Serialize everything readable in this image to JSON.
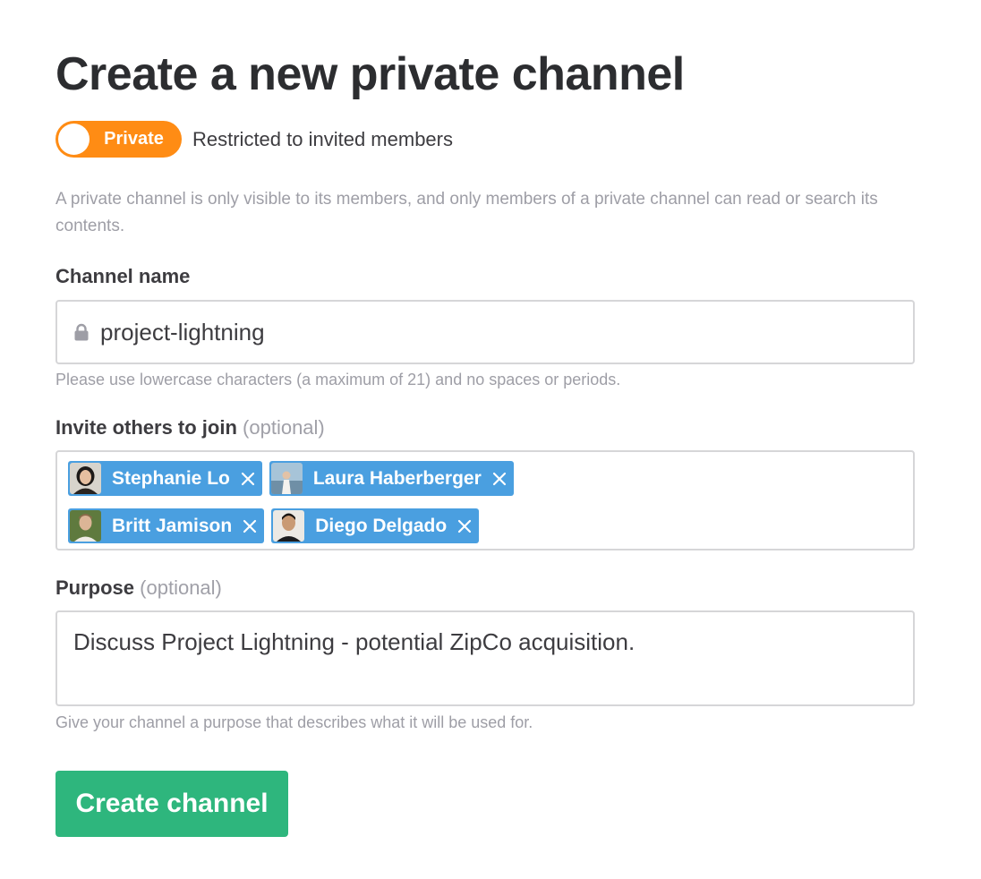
{
  "page": {
    "title": "Create a new private channel"
  },
  "privacy_toggle": {
    "label": "Private",
    "description": "Restricted to invited members",
    "color": "#ff8c14"
  },
  "description": "A private channel is only visible to its members, and only members of a private channel can read or search its contents.",
  "channel_name": {
    "label": "Channel name",
    "value": "project-lightning",
    "hint": "Please use lowercase characters (a maximum of 21) and no spaces or periods.",
    "icon": "lock-icon"
  },
  "invite": {
    "label": "Invite others to join",
    "optional": "(optional)",
    "chip_color": "#4a9fe0",
    "members": [
      {
        "name": "Stephanie Lo"
      },
      {
        "name": "Laura Haberberger"
      },
      {
        "name": "Britt Jamison"
      },
      {
        "name": "Diego Delgado"
      }
    ]
  },
  "purpose": {
    "label": "Purpose",
    "optional": "(optional)",
    "value": "Discuss Project Lightning - potential ZipCo acquisition.",
    "hint": "Give your channel a purpose that describes what it will be used for."
  },
  "actions": {
    "create_label": "Create channel",
    "create_color": "#2eb67d"
  }
}
